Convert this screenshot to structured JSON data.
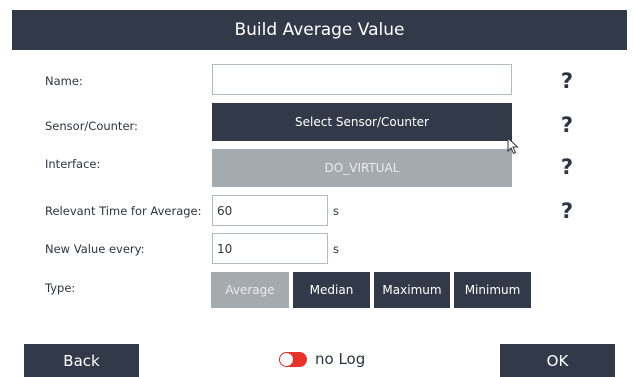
{
  "dialog": {
    "title": "Build Average Value"
  },
  "form": {
    "name": {
      "label": "Name:",
      "value": ""
    },
    "sensor": {
      "label": "Sensor/Counter:",
      "button": "Select Sensor/Counter"
    },
    "interface": {
      "label": "Interface:",
      "value": "DO_VIRTUAL"
    },
    "relevant_time": {
      "label": "Relevant Time for Average:",
      "value": "60",
      "unit": "s"
    },
    "new_value_every": {
      "label": "New Value every:",
      "value": "10",
      "unit": "s"
    },
    "type": {
      "label": "Type:",
      "options": [
        "Average",
        "Median",
        "Maximum",
        "Minimum"
      ],
      "selected": "Average"
    },
    "help_symbol": "?"
  },
  "footer": {
    "back_label": "Back",
    "ok_label": "OK",
    "log_toggle": {
      "label": "no Log",
      "enabled": false
    }
  },
  "colors": {
    "primary": "#323a4a",
    "disabled": "#a5aaaf",
    "toggle_off": "#e8332b"
  }
}
